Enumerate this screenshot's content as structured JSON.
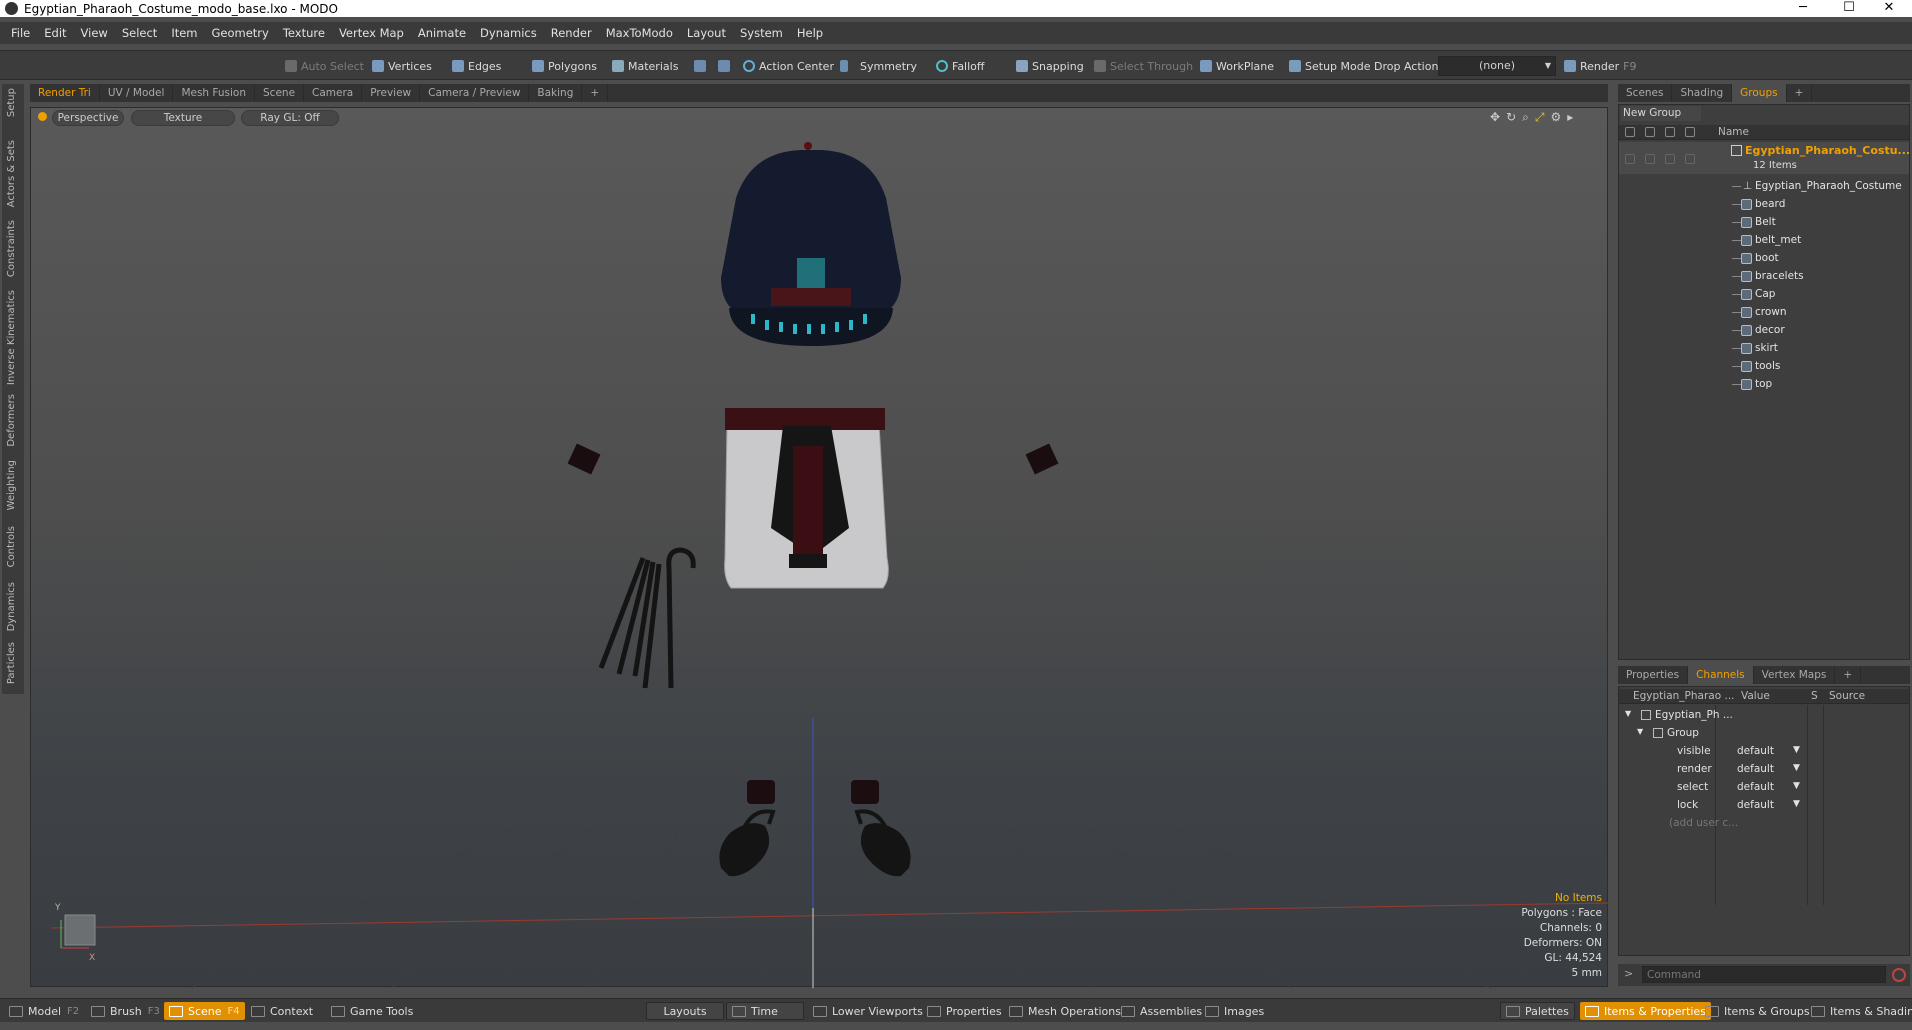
{
  "window": {
    "title": "Egyptian_Pharaoh_Costume_modo_base.lxo - MODO",
    "minimize": "─",
    "maximize": "☐",
    "close": "✕"
  },
  "menu": [
    "File",
    "Edit",
    "View",
    "Select",
    "Item",
    "Geometry",
    "Texture",
    "Vertex Map",
    "Animate",
    "Dynamics",
    "Render",
    "MaxToModo",
    "Layout",
    "System",
    "Help"
  ],
  "toolbar": {
    "auto_select": "Auto Select",
    "vertices": "Vertices",
    "edges": "Edges",
    "polygons": "Polygons",
    "materials": "Materials",
    "action_center": "Action Center",
    "symmetry": "Symmetry",
    "falloff": "Falloff",
    "snapping": "Snapping",
    "select_through": "Select Through",
    "workplane": "WorkPlane",
    "setup_mode": "Setup Mode",
    "drop_action": "Drop Action",
    "drop_value": "(none)",
    "render": "Render",
    "render_key": "F9"
  },
  "left_tabs": [
    "Setup",
    "Actors & Sets",
    "Constraints",
    "Inverse Kinematics",
    "Deformers",
    "Weighting",
    "Controls",
    "Dynamics",
    "Particles"
  ],
  "viewport_tabs": [
    "Render Tri",
    "UV / Model",
    "Mesh Fusion",
    "Scene",
    "Camera",
    "Preview",
    "Camera / Preview",
    "Baking",
    "+"
  ],
  "viewport": {
    "view_mode": "Perspective",
    "shading": "Texture",
    "raygl": "Ray GL: Off",
    "axis_y": "Y",
    "axis_x": "X",
    "info": {
      "items": "No Items",
      "polygons": "Polygons : Face",
      "channels": "Channels: 0",
      "deformers": "Deformers: ON",
      "gl": "GL: 44,524",
      "unit": "5 mm"
    }
  },
  "scene_tabs": [
    "Scenes",
    "Shading",
    "Groups",
    "+"
  ],
  "groups": {
    "new_group": "New Group",
    "name_header": "Name",
    "root": "Egyptian_Pharaoh_Costu...",
    "count": "12 Items",
    "items": [
      "Egyptian_Pharaoh_Costume",
      "beard",
      "Belt",
      "belt_met",
      "boot",
      "bracelets",
      "Cap",
      "crown",
      "decor",
      "skirt",
      "tools",
      "top"
    ]
  },
  "prop_tabs": [
    "Properties",
    "Channels",
    "Vertex Maps",
    "+"
  ],
  "channels": {
    "col_name": "Egyptian_Pharao ...",
    "col_value": "Value",
    "col_s": "S",
    "col_source": "Source",
    "root": "Egyptian_Ph ...",
    "group": "Group",
    "rows": [
      {
        "name": "visible",
        "value": "default"
      },
      {
        "name": "render",
        "value": "default"
      },
      {
        "name": "select",
        "value": "default"
      },
      {
        "name": "lock",
        "value": "default"
      }
    ],
    "add_user": "(add user c..."
  },
  "command": {
    "placeholder": "Command"
  },
  "bottom": {
    "model": "Model",
    "model_key": "F2",
    "brush": "Brush",
    "brush_key": "F3",
    "scene": "Scene",
    "scene_key": "F4",
    "context": "Context",
    "game_tools": "Game Tools",
    "layouts": "Layouts",
    "time": "Time",
    "lower_viewports": "Lower Viewports",
    "properties": "Properties",
    "mesh_operations": "Mesh Operations",
    "assemblies": "Assemblies",
    "images": "Images",
    "palettes": "Palettes",
    "items_properties": "Items & Properties",
    "items_groups": "Items & Groups",
    "items_shading": "Items & Shading"
  },
  "colors": {
    "accent": "#f0a000",
    "active_tab": "#e09000",
    "cyan_detail": "#2fb6c8",
    "dark_red": "#5a0f12"
  }
}
